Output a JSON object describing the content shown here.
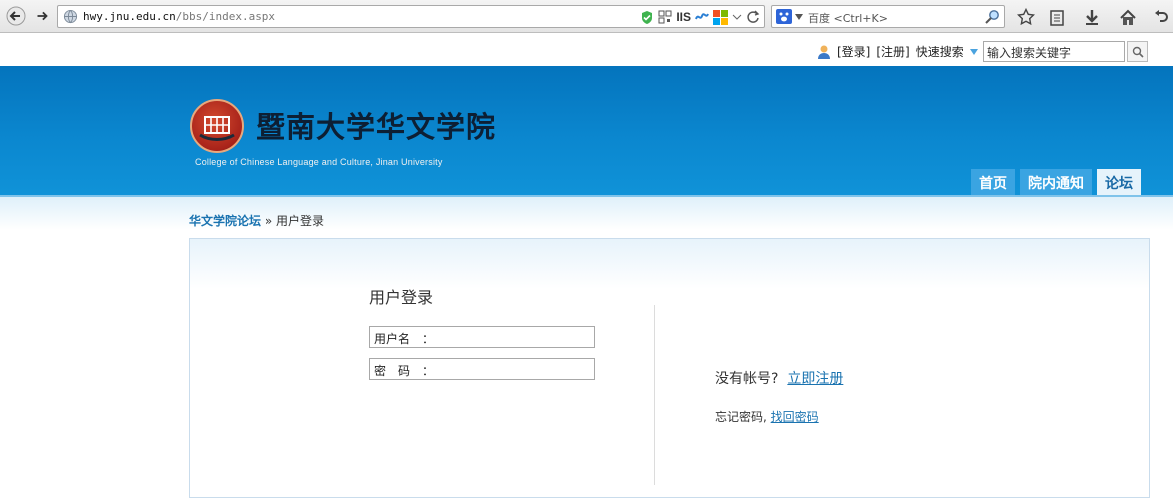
{
  "browser": {
    "url_host": "hwy.jnu.edu.cn",
    "url_path": "/bbs/index.aspx",
    "url_badge": "IIS",
    "search_engine": "百度",
    "search_placeholder": "百度 <Ctrl+K>"
  },
  "topbar": {
    "login": "[登录]",
    "register": "[注册]",
    "quick_search": "快速搜索",
    "quick_search_placeholder": "输入搜索关键字"
  },
  "header": {
    "site_title": "暨南大学华文学院",
    "site_subtitle": "College of Chinese Language and Culture, Jinan University",
    "nav": [
      {
        "label": "首页"
      },
      {
        "label": "院内通知"
      },
      {
        "label": "论坛"
      }
    ],
    "colors": {
      "banner": "#0b87cf",
      "active_tab": "#e6f3fb"
    }
  },
  "breadcrumb": {
    "home": "华文学院论坛",
    "sep": "»",
    "current": "用户登录"
  },
  "login": {
    "title": "用户登录",
    "username_label": "用户名　：",
    "password_label": "密　码　：",
    "no_account": "没有帐号?",
    "register_now": "立即注册",
    "forgot": "忘记密码,",
    "recover": "找回密码"
  }
}
